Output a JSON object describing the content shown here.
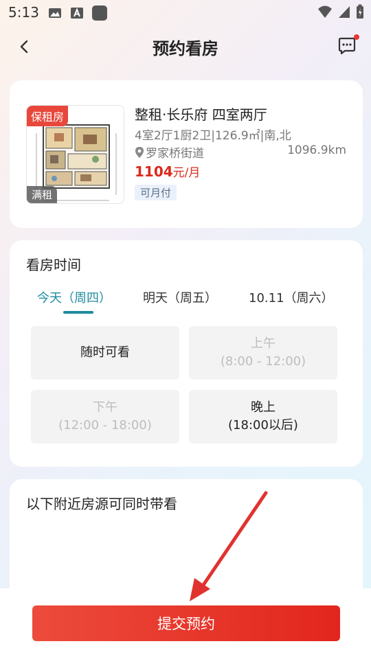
{
  "status_bar": {
    "time": "5:13"
  },
  "header": {
    "title": "预约看房"
  },
  "listing": {
    "tag_rent": "保租房",
    "tag_status": "满租",
    "title": "整租·长乐府 四室两厅",
    "spec": "4室2厅1厨2卫|126.9㎡|南,北",
    "location": "罗家桥街道",
    "distance": "1096.9km",
    "price_value": "1104",
    "price_unit": "元/月",
    "pay_tag": "可月付"
  },
  "viewing_time": {
    "title": "看房时间",
    "tabs": [
      {
        "label": "今天（周四）",
        "active": true
      },
      {
        "label": "明天（周五）",
        "active": false
      },
      {
        "label": "10.11（周六）",
        "active": false
      }
    ],
    "slots": [
      {
        "line1": "随时可看",
        "line2": "",
        "enabled": true
      },
      {
        "line1": "上午",
        "line2": "(8:00 - 12:00)",
        "enabled": false
      },
      {
        "line1": "下午",
        "line2": "(12:00 - 18:00)",
        "enabled": false
      },
      {
        "line1": "晚上",
        "line2": "(18:00以后)",
        "enabled": true
      }
    ]
  },
  "nearby": {
    "title": "以下附近房源可同时带看"
  },
  "submit": {
    "label": "提交预约"
  },
  "colors": {
    "accent": "#1f8ba0",
    "price": "#d92a1c",
    "button": "#e2261d",
    "arrow": "#e0332f"
  }
}
